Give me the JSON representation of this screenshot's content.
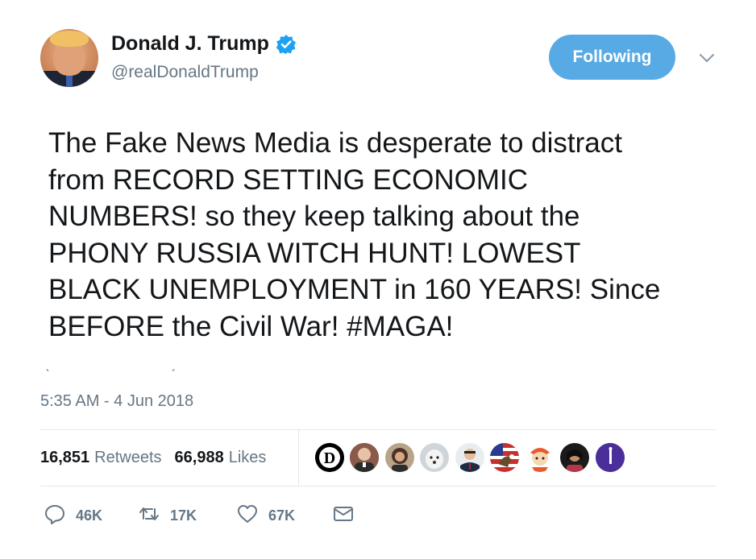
{
  "user": {
    "name": "Donald J. Trump",
    "handle": "@realDonaldTrump",
    "verified": true
  },
  "follow_button": {
    "label": "Following"
  },
  "tweet": {
    "lines": [
      "The Fake News Media is desperate to distract",
      "from RECORD SETTING ECONOMIC",
      "NUMBERS! so they keep talking about the",
      "PHONY RUSSIA WITCH HUNT!  LOWEST",
      "BLACK UNEMPLOYMENT in 160 YEARS! Since",
      "BEFORE the Civil War!  #MAGA!"
    ],
    "timestamp": "5:35 AM - 4 Jun 2018"
  },
  "stats": {
    "retweets_count": "16,851",
    "retweets_label": "Retweets",
    "likes_count": "66,988",
    "likes_label": "Likes"
  },
  "liker_avatars": [
    {
      "icon": "detroit-d-logo"
    },
    {
      "icon": "person-avatar"
    },
    {
      "icon": "person-avatar"
    },
    {
      "icon": "dog-avatar"
    },
    {
      "icon": "person-avatar"
    },
    {
      "icon": "eagle-flag-avatar"
    },
    {
      "icon": "cartoon-avatar"
    },
    {
      "icon": "person-avatar"
    },
    {
      "icon": "silhouette-avatar"
    }
  ],
  "actions": {
    "replies": "46K",
    "retweets": "17K",
    "likes": "67K"
  },
  "colors": {
    "accent": "#58aae4",
    "verified": "#1da1f2",
    "secondary_text": "#657786",
    "divider": "#e1e8ed"
  }
}
